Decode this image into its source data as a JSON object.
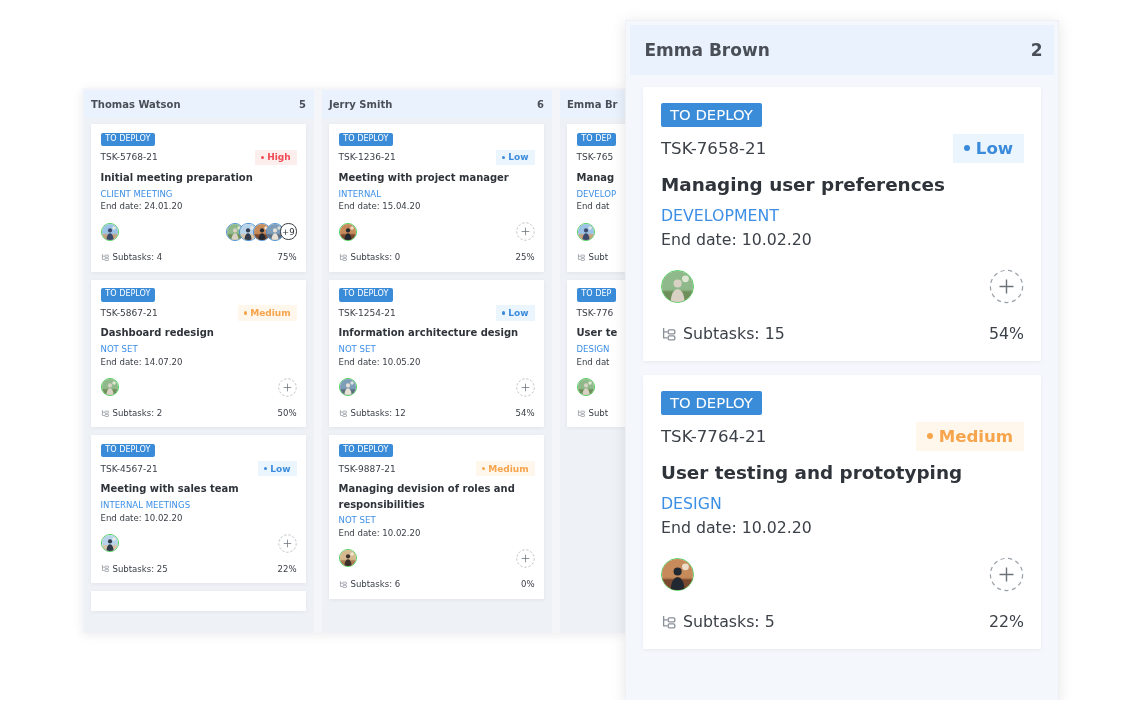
{
  "board": {
    "columns": [
      {
        "name": "Thomas Watson",
        "count": "5",
        "cards": [
          {
            "status": "TO DEPLOY",
            "id": "TSK-5768-21",
            "priority": {
              "kind": "high",
              "label": "High"
            },
            "title": "Initial meeting preparation",
            "tag": "CLIENT MEETING",
            "end_date": "End date: 24.01.20",
            "watchers_more": "+9",
            "add_button": false,
            "subtasks": "Subtasks: 4",
            "percent": "75%"
          },
          {
            "status": "TO DEPLOY",
            "id": "TSK-5867-21",
            "priority": {
              "kind": "medium",
              "label": "Medium"
            },
            "title": "Dashboard redesign",
            "tag": "NOT SET",
            "end_date": "End date: 14.07.20",
            "add_button": true,
            "subtasks": "Subtasks: 2",
            "percent": "50%"
          },
          {
            "status": "TO DEPLOY",
            "id": "TSK-4567-21",
            "priority": {
              "kind": "low",
              "label": "Low"
            },
            "title": "Meeting with sales team",
            "tag": "INTERNAL MEETINGS",
            "end_date": "End date: 10.02.20",
            "add_button": true,
            "subtasks": "Subtasks: 25",
            "percent": "22%"
          }
        ],
        "more_below": true
      },
      {
        "name": "Jerry Smith",
        "count": "6",
        "cards": [
          {
            "status": "TO DEPLOY",
            "id": "TSK-1236-21",
            "priority": {
              "kind": "low",
              "label": "Low"
            },
            "title": "Meeting with project manager",
            "tag": "INTERNAL",
            "end_date": "End date: 15.04.20",
            "add_button": true,
            "subtasks": "Subtasks: 0",
            "percent": "25%"
          },
          {
            "status": "TO DEPLOY",
            "id": "TSK-1254-21",
            "priority": {
              "kind": "low",
              "label": "Low"
            },
            "title": "Information architecture design",
            "tag": "NOT SET",
            "end_date": "End date: 10.05.20",
            "add_button": true,
            "subtasks": "Subtasks: 12",
            "percent": "54%"
          },
          {
            "status": "TO DEPLOY",
            "id": "TSK-9887-21",
            "priority": {
              "kind": "medium",
              "label": "Medium"
            },
            "title": "Managing devision of roles and responsibilities",
            "tag": "NOT SET",
            "end_date": "End date: 10.02.20",
            "add_button": true,
            "subtasks": "Subtasks: 6",
            "percent": "0%"
          }
        ],
        "more_below": false
      },
      {
        "name": "Emma Br",
        "cards": [
          {
            "status": "TO DEP",
            "id": "TSK-765",
            "title": "Manag",
            "tag": "DEVELOP",
            "end_date": "End dat",
            "add_button": false,
            "subtasks": "Subt"
          },
          {
            "status": "TO DEP",
            "id": "TSK-776",
            "title": "User te",
            "tag": "DESIGN",
            "end_date": "End dat",
            "add_button": false,
            "subtasks": "Subt"
          }
        ],
        "more_below": false
      }
    ]
  },
  "detail_panel": {
    "name": "Emma Brown",
    "count": "2",
    "cards": [
      {
        "status": "TO DEPLOY",
        "id": "TSK-7658-21",
        "priority": {
          "kind": "low",
          "label": "Low"
        },
        "title": "Managing user preferences",
        "tag": "DEVELOPMENT",
        "end_date": "End date: 10.02.20",
        "add_button": true,
        "subtasks": "Subtasks: 15",
        "percent": "54%"
      },
      {
        "status": "TO DEPLOY",
        "id": "TSK-7764-21",
        "priority": {
          "kind": "medium",
          "label": "Medium"
        },
        "title": "User testing and prototyping",
        "tag": "DESIGN",
        "end_date": "End date: 10.02.20",
        "add_button": true,
        "subtasks": "Subtasks: 5",
        "percent": "22%"
      }
    ]
  }
}
